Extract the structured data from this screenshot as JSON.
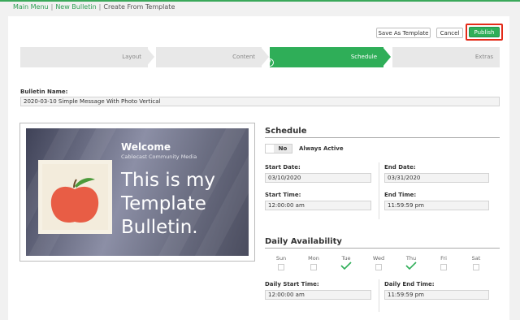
{
  "breadcrumb": {
    "main_menu": "Main Menu",
    "new_bulletin": "New Bulletin",
    "current": "Create From Template",
    "separator": "|"
  },
  "toolbar": {
    "save_template": "Save As Template",
    "cancel": "Cancel",
    "publish": "Publish"
  },
  "wizard": {
    "steps": [
      {
        "label": "Layout",
        "state": "done"
      },
      {
        "label": "Content",
        "state": "done"
      },
      {
        "label": "Schedule",
        "state": "active"
      },
      {
        "label": "Extras",
        "state": "upcoming"
      }
    ],
    "help_glyph": "?"
  },
  "bulletin": {
    "name_label": "Bulletin Name:",
    "name_value": "2020-03-10 Simple Message With Photo Vertical"
  },
  "preview": {
    "welcome": "Welcome",
    "station": "Cablecast Community Media",
    "lines": [
      "This is my",
      "Template",
      "Bulletin."
    ]
  },
  "schedule": {
    "title": "Schedule",
    "toggle_value": "No",
    "always_active_label": "Always Active",
    "start_date_label": "Start Date:",
    "start_date": "03/10/2020",
    "end_date_label": "End Date:",
    "end_date": "03/31/2020",
    "start_time_label": "Start Time:",
    "start_time": "12:00:00 am",
    "end_time_label": "End Time:",
    "end_time": "11:59:59 pm"
  },
  "availability": {
    "title": "Daily Availability",
    "days": [
      {
        "label": "Sun",
        "checked": false
      },
      {
        "label": "Mon",
        "checked": false
      },
      {
        "label": "Tue",
        "checked": true
      },
      {
        "label": "Wed",
        "checked": false
      },
      {
        "label": "Thu",
        "checked": true
      },
      {
        "label": "Fri",
        "checked": false
      },
      {
        "label": "Sat",
        "checked": false
      }
    ],
    "daily_start_label": "Daily Start Time:",
    "daily_start": "12:00:00 am",
    "daily_end_label": "Daily End Time:",
    "daily_end": "11:59:59 pm"
  },
  "colors": {
    "accent": "#2fae58",
    "highlight": "#e32a18"
  }
}
